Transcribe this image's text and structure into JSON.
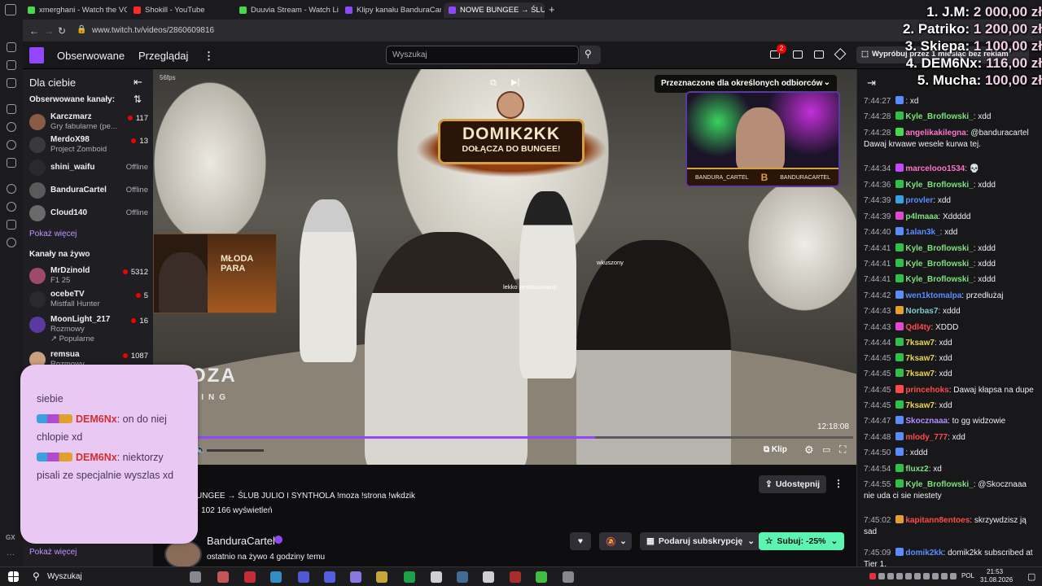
{
  "browser": {
    "tabs": [
      {
        "label": "xmerghani - Watch the VO",
        "color": "#4ad84a"
      },
      {
        "label": "Shokill - YouTube",
        "color": "#ff2a2a"
      },
      {
        "label": "Duuvia Stream - Watch Liv",
        "color": "#4ad84a"
      },
      {
        "label": "Klipy kanału BanduraCartel",
        "color": "#9147ff"
      },
      {
        "label": "NOWE BUNGEE → ŚLUB",
        "color": "#9147ff"
      }
    ],
    "url": "www.twitch.tv/videos/2860609816"
  },
  "nav": {
    "following": "Obserwowane",
    "browse": "Przeglądaj",
    "more_icon": "more-vertical-icon",
    "search_placeholder": "Wyszukaj",
    "notif_count": "2",
    "prime_text": "Wypróbuj przez 1 miesiąc bez reklam"
  },
  "sidebar": {
    "title": "Dla ciebie",
    "followed_heading": "Obserwowane kanały:",
    "followed": [
      {
        "name": "Karczmarz",
        "category": "Gry fabularne (pe...",
        "viewers": "117",
        "live": true
      },
      {
        "name": "MerdoX98",
        "category": "Project Zomboid",
        "viewers": "13",
        "live": true
      },
      {
        "name": "shini_waifu",
        "category": "",
        "viewers": "Offline",
        "live": false
      },
      {
        "name": "BanduraCartel",
        "category": "",
        "viewers": "Offline",
        "live": false
      },
      {
        "name": "Cloud140",
        "category": "",
        "viewers": "Offline",
        "live": false
      }
    ],
    "show_more": "Pokaż więcej",
    "live_heading": "Kanały na żywo",
    "live": [
      {
        "name": "MrDzinold",
        "category": "F1 25",
        "viewers": "5312"
      },
      {
        "name": "ocebeTV",
        "category": "Mistfall Hunter",
        "viewers": "5"
      },
      {
        "name": "MoonLight_217",
        "category": "Rozmowy",
        "viewers": "16",
        "tag": "↗ Popularne"
      },
      {
        "name": "remsua",
        "category": "Rozmowy",
        "viewers": "1087"
      }
    ],
    "show_more_bottom": "Pokaż więcej"
  },
  "video": {
    "fps_label": "56fps",
    "banner_title": "DOMIK2KK",
    "banner_sub": "DOŁĄCZA DO BUNGEE!",
    "audience_label": "Przeznaczone dla określonych odbiorców",
    "pip_title": "MŁODA PARA",
    "cam_tag_left": "BANDURA_CARTEL",
    "cam_tag_right": "BANDURACARTEL",
    "name_tag_1": "lekko zestresowany",
    "name_tag_2": "wkuszony",
    "logo_text": "OZA",
    "logo_sub": "CING",
    "duration": "12:18:08",
    "progress": 0.63,
    "clip_label": "Klip"
  },
  "overlay": {
    "lines": [
      {
        "name": "",
        "text": "siebie"
      },
      {
        "name": "DEM6Nx",
        "text": ": on do niej chlopie xd"
      },
      {
        "name": "DEM6Nx",
        "text": ": niektorzy pisali ze specjalnie wyszlas xd"
      }
    ]
  },
  "info": {
    "title": "UNGEE → ŚLUB JULIO I SYNTHOLA !moza !strona !wkdzik",
    "views": "· 102 166 wyświetleń",
    "share": "Udostępnij",
    "channel": "BanduraCartel",
    "last_live": "ostatnio na żywo 4 godziny temu",
    "gift": "Podaruj subskrypcję",
    "subscribe": "Subuj: -25%"
  },
  "leaderboard": [
    {
      "rank": "1. J.M:",
      "value": "2 000,00 zł"
    },
    {
      "rank": "2. Patriko:",
      "value": "1 200,00 zł"
    },
    {
      "rank": "3. Skiepa:",
      "value": "1 100,00 zł"
    },
    {
      "rank": "4. DEM6Nx:",
      "value": "116,00 zł"
    },
    {
      "rank": "5. Mucha:",
      "value": "100,00 zł"
    }
  ],
  "chat": [
    {
      "time": "7:44:27",
      "nick": "",
      "color": "#5b8cff",
      "text": ": xd"
    },
    {
      "time": "7:44:28",
      "nick": "Kyle_Broflowski_",
      "color": "#7ee07e",
      "text": ": xdd"
    },
    {
      "time": "7:44:28",
      "nick": "angelikakilegna",
      "color": "#ff74c8",
      "text": ": @banduracartel Dawaj krwawe wesele kurwa tej."
    },
    {
      "time": "7:44:34",
      "nick": "marcelooo1534",
      "color": "#ff74c8",
      "text": ": 💀"
    },
    {
      "time": "7:44:36",
      "nick": "Kyle_Broflowski_",
      "color": "#7ee07e",
      "text": ": xddd"
    },
    {
      "time": "7:44:39",
      "nick": "provler",
      "color": "#5b8cff",
      "text": ": xdd"
    },
    {
      "time": "7:44:39",
      "nick": "p4lmaaa",
      "color": "#7ee07e",
      "text": ": Xddddd"
    },
    {
      "time": "7:44:40",
      "nick": "1alan3k_",
      "color": "#5b8cff",
      "text": ": xdd"
    },
    {
      "time": "7:44:41",
      "nick": "Kyle_Broflowski_",
      "color": "#7ee07e",
      "text": ": xddd"
    },
    {
      "time": "7:44:41",
      "nick": "Kyle_Broflowski_",
      "color": "#7ee07e",
      "text": ": xddd"
    },
    {
      "time": "7:44:41",
      "nick": "Kyle_Broflowski_",
      "color": "#7ee07e",
      "text": ": xddd"
    },
    {
      "time": "7:44:42",
      "nick": "wen1ktomalpa",
      "color": "#5b8cff",
      "text": ": przedłużaj"
    },
    {
      "time": "7:44:43",
      "nick": "Norbas7",
      "color": "#7ec8c8",
      "text": ": xddd"
    },
    {
      "time": "7:44:43",
      "nick": "Qdl4ty",
      "color": "#ff4a4a",
      "text": ": XDDD"
    },
    {
      "time": "7:44:44",
      "nick": "7ksaw7",
      "color": "#e8d84a",
      "text": ": xdd"
    },
    {
      "time": "7:44:45",
      "nick": "7ksaw7",
      "color": "#e8d84a",
      "text": ": xdd"
    },
    {
      "time": "7:44:45",
      "nick": "7ksaw7",
      "color": "#e8d84a",
      "text": ": xdd"
    },
    {
      "time": "7:44:45",
      "nick": "princehoks",
      "color": "#ff4a4a",
      "text": ": Dawaj kłapsa na dupe"
    },
    {
      "time": "7:44:45",
      "nick": "7ksaw7",
      "color": "#e8d84a",
      "text": ": xdd"
    },
    {
      "time": "7:44:47",
      "nick": "Skocznaaa",
      "color": "#b48cff",
      "text": ": to gg widzowie"
    },
    {
      "time": "7:44:48",
      "nick": "mlody_777",
      "color": "#ff4a4a",
      "text": ": xdd"
    },
    {
      "time": "7:44:50",
      "nick": "",
      "color": "#5b8cff",
      "text": ": xddd"
    },
    {
      "time": "7:44:54",
      "nick": "fluxz2",
      "color": "#7ee07e",
      "text": ": xd"
    },
    {
      "time": "7:44:55",
      "nick": "Kyle_Broflowski_",
      "color": "#7ee07e",
      "text": ": @Skocznaaa nie uda ci sie niestety"
    },
    {
      "time": "7:45:02",
      "nick": "kapitann8entoes",
      "color": "#ff4a4a",
      "text": ": skrzywdzisz ją sad"
    },
    {
      "time": "7:45:09",
      "nick": "domik2kk",
      "color": "#5b8cff",
      "text": ": domik2kk subscribed at Tier 1."
    }
  ],
  "taskbar": {
    "search": "Wyszukaj",
    "lang": "POL",
    "time": "21:53",
    "date": "31.08.2026"
  }
}
